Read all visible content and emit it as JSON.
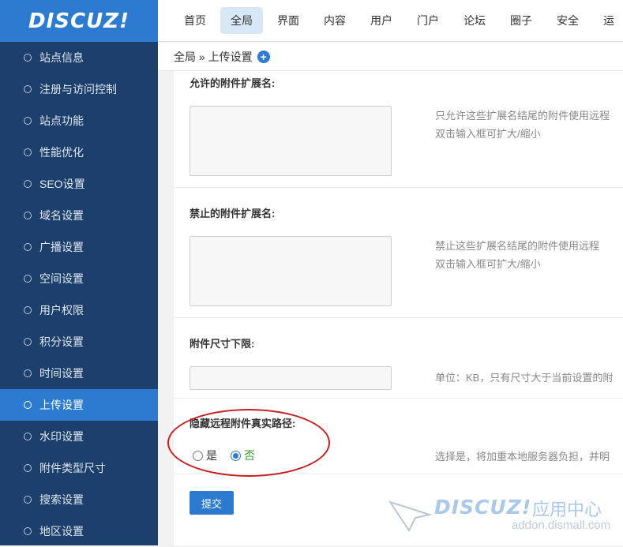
{
  "logo": "DISCUZ!",
  "sidebar": {
    "items": [
      {
        "label": "站点信息"
      },
      {
        "label": "注册与访问控制"
      },
      {
        "label": "站点功能"
      },
      {
        "label": "性能优化"
      },
      {
        "label": "SEO设置"
      },
      {
        "label": "域名设置"
      },
      {
        "label": "广播设置"
      },
      {
        "label": "空间设置"
      },
      {
        "label": "用户权限"
      },
      {
        "label": "积分设置"
      },
      {
        "label": "时间设置"
      },
      {
        "label": "上传设置",
        "active": true
      },
      {
        "label": "水印设置"
      },
      {
        "label": "附件类型尺寸"
      },
      {
        "label": "搜索设置"
      },
      {
        "label": "地区设置"
      }
    ]
  },
  "topnav": {
    "items": [
      "首页",
      "全局",
      "界面",
      "内容",
      "用户",
      "门户",
      "论坛",
      "圈子",
      "安全",
      "运"
    ],
    "active_index": 1
  },
  "breadcrumb": {
    "text": "全局 » 上传设置",
    "add_icon": "plus-circle-icon"
  },
  "form": {
    "allowed_ext": {
      "label": "允许的附件扩展名:",
      "hint1": "只允许这些扩展名结尾的附件使用远程",
      "hint2": "双击输入框可扩大/缩小",
      "value": ""
    },
    "banned_ext": {
      "label": "禁止的附件扩展名:",
      "hint1": "禁止这些扩展名结尾的附件使用远程",
      "hint2": "双击输入框可扩大/缩小",
      "value": ""
    },
    "min_size": {
      "label": "附件尺寸下限:",
      "hint": "单位：KB，只有尺寸大于当前设置的附",
      "value": ""
    },
    "hide_path": {
      "label": "隐藏远程附件真实路径:",
      "yes": "是",
      "no": "否",
      "selected": "no",
      "hint": "选择是，将加重本地服务器负担，并明"
    },
    "submit_label": "提交"
  },
  "watermark": {
    "logo": "DISCUZ!",
    "cn": "应用中心",
    "url": "addon.dismall.com"
  },
  "colors": {
    "sidebar_bg": "#1c3f6b",
    "accent": "#2c7bd1",
    "annotation": "#c81d1d"
  }
}
